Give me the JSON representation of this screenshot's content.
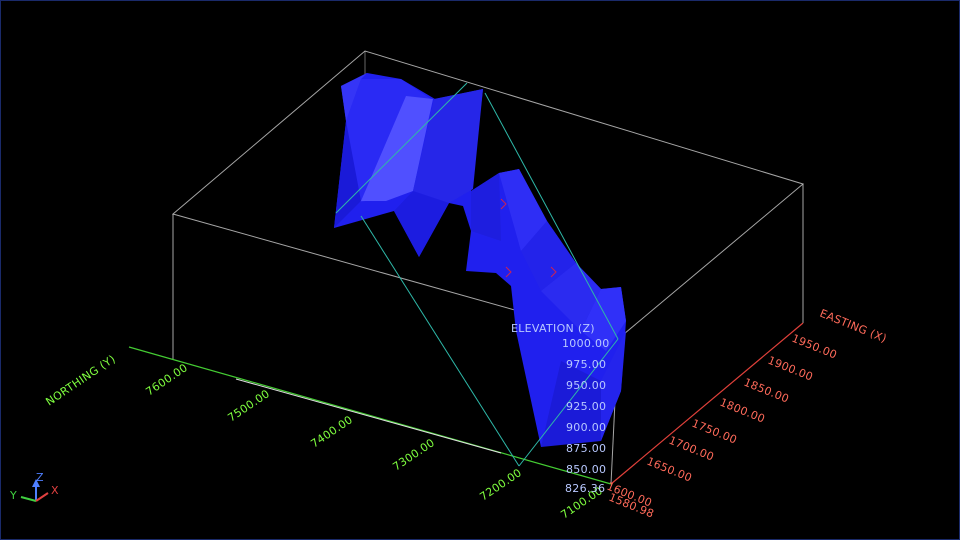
{
  "viewer": {
    "background": "#000000",
    "frame_color": "#1a2a6a"
  },
  "colors": {
    "box_edges": "#d0d0d0",
    "northing_axis": "#44cc33",
    "northing_text": "#7fff3f",
    "easting_axis": "#e0403a",
    "easting_text": "#ff6a5a",
    "elevation_text": "#b8c8ff",
    "solid": "#2020ee",
    "section_lines": "#2eb8a8"
  },
  "axes": {
    "northing": {
      "title": "NORTHING (Y)",
      "ticks": [
        "7600.00",
        "7500.00",
        "7400.00",
        "7300.00",
        "7200.00",
        "7100.00"
      ]
    },
    "easting": {
      "title": "EASTING (X)",
      "ticks": [
        "1580.98",
        "1600.00",
        "1650.00",
        "1700.00",
        "1750.00",
        "1800.00",
        "1850.00",
        "1900.00",
        "1950.00"
      ]
    },
    "elevation": {
      "title": "ELEVATION (Z)",
      "ticks": [
        "1000.00",
        "975.00",
        "950.00",
        "925.00",
        "900.00",
        "875.00",
        "850.00",
        "826.36"
      ]
    }
  },
  "triad": {
    "z_label": "Z",
    "y_label": "Y",
    "x_label": "X"
  }
}
